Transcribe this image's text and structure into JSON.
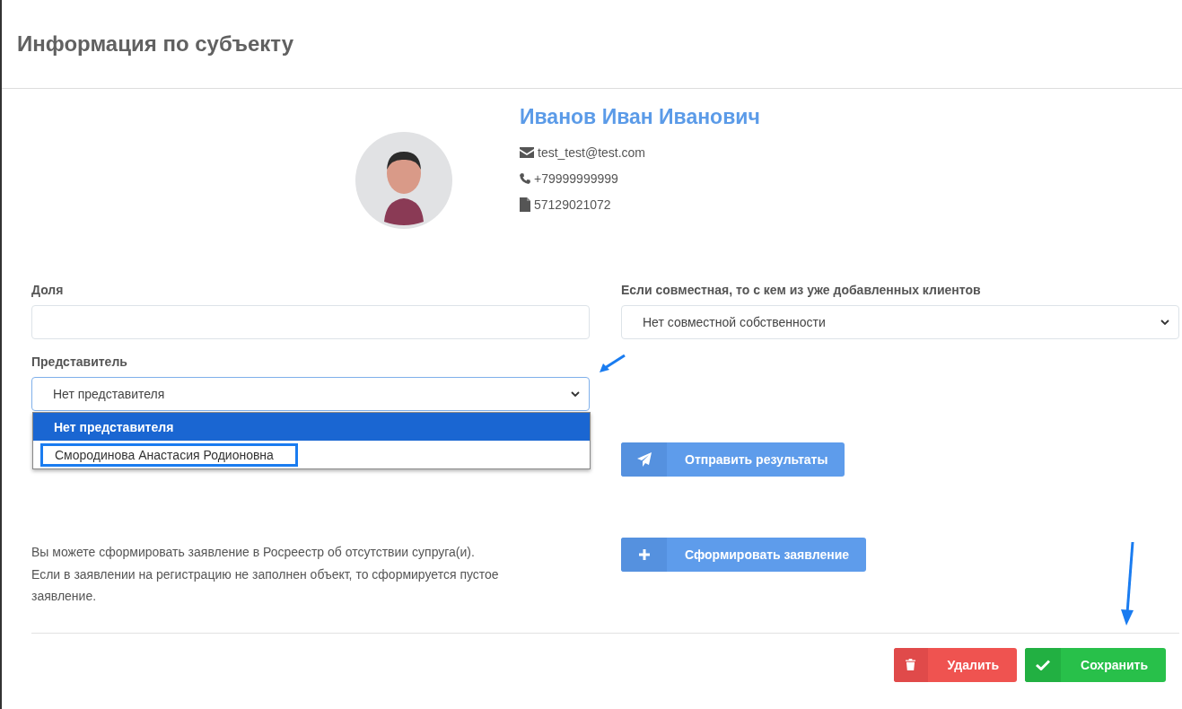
{
  "modal": {
    "title": "Информация по субъекту"
  },
  "profile": {
    "name": "Иванов Иван Иванович",
    "email": "test_test@test.com",
    "phone": "+79999999999",
    "document": "57129021072"
  },
  "share": {
    "label": "Доля"
  },
  "joint_owner": {
    "label": "Если совместная, то с кем из уже добавленных клиентов",
    "value": "Нет совместной собственности"
  },
  "representative": {
    "label": "Представитель",
    "value": "Нет представителя",
    "expanded": true,
    "options": [
      {
        "label": "Нет представителя",
        "selected": true
      },
      {
        "label": "Смородинова Анастасия Родионовна",
        "selected": false,
        "highlighted": true
      }
    ]
  },
  "send_button": {
    "label": "Отправить результаты",
    "kind": "send"
  },
  "statement": {
    "text": [
      "Вы можете сформировать заявление в Росреестр об отсутствии супруга(и).",
      "Если в заявлении на регистрацию не заполнен объект, то сформируется пустое заявление."
    ],
    "button": {
      "label": "Сформировать заявление",
      "kind": "add"
    }
  },
  "footer_buttons": [
    {
      "label": "Удалить",
      "kind": "delete"
    },
    {
      "label": "Сохранить",
      "kind": "save"
    }
  ]
}
